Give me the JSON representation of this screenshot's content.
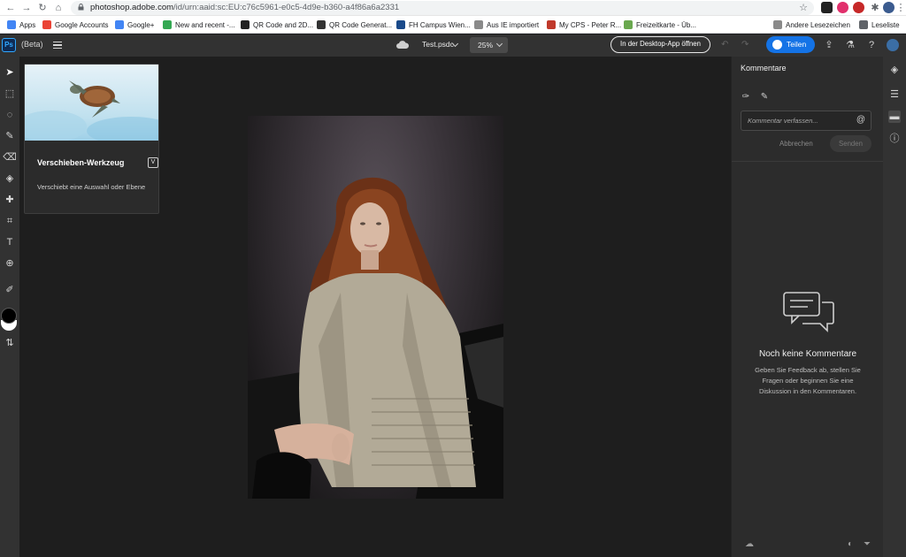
{
  "browser": {
    "url_host": "photoshop.adobe.com",
    "url_path": "/id/urn:aaid:sc:EU:c76c5961-e0c5-4d9e-b360-a4f86a6a2331",
    "bookmarks": [
      {
        "label": "Apps",
        "color": "#4285f4"
      },
      {
        "label": "Google Accounts",
        "color": "#ea4335"
      },
      {
        "label": "Google+",
        "color": "#4285f4"
      },
      {
        "label": "New and recent -...",
        "color": "#34a853"
      },
      {
        "label": "QR Code and 2D...",
        "color": "#222222"
      },
      {
        "label": "QR Code Generat...",
        "color": "#333333"
      },
      {
        "label": "FH Campus Wien...",
        "color": "#1a4a8a"
      },
      {
        "label": "Aus IE importiert",
        "color": "#8a8a8a"
      },
      {
        "label": "My CPS - Peter R...",
        "color": "#c0392b"
      },
      {
        "label": "Freizeitkarte - Üb...",
        "color": "#6aa84f"
      },
      {
        "label": "Andere Lesezeichen",
        "color": "#8a8a8a"
      },
      {
        "label": "Leseliste",
        "color": "#5f6368"
      }
    ]
  },
  "app": {
    "logo": "Ps",
    "beta_label": "(Beta)",
    "doc_name": "Test.psdc",
    "zoom": "25%",
    "desktop_button": "In der Desktop-App öffnen",
    "share_button": "Teilen",
    "accent": "#1473e6"
  },
  "tooltip": {
    "title": "Verschieben-Werkzeug",
    "shortcut": "V",
    "description": "Verschiebt eine Auswahl oder Ebene"
  },
  "comments": {
    "title": "Kommentare",
    "placeholder": "Kommentar verfassen...",
    "at_symbol": "@",
    "cancel": "Abbrechen",
    "send": "Senden",
    "empty_title": "Noch keine Kommentare",
    "empty_desc": "Geben Sie Feedback ab, stellen Sie Fragen oder beginnen Sie eine Diskussion in den Kommentaren."
  }
}
